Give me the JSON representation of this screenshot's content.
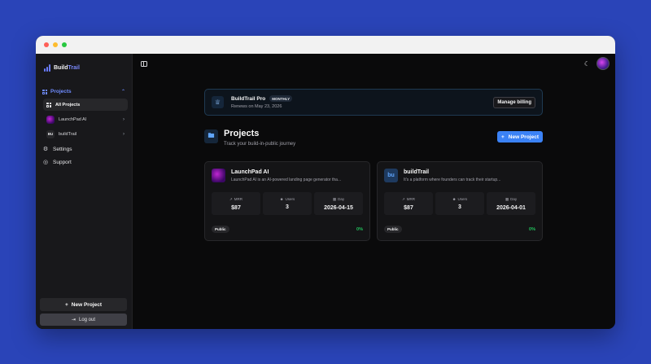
{
  "brand": {
    "name_part1": "Build",
    "name_part2": "Trail"
  },
  "sidebar": {
    "projects_label": "Projects",
    "all_projects_label": "All Projects",
    "projects": [
      {
        "name": "LaunchPad AI"
      },
      {
        "name": "buildTrail",
        "mono": "BU"
      }
    ],
    "settings_label": "Settings",
    "support_label": "Support",
    "new_project_label": "New Project",
    "logout_label": "Log out"
  },
  "billing": {
    "plan": "BuildTrail Pro",
    "badge": "MONTHLY",
    "renews": "Renews on May 23, 2026",
    "manage_label": "Manage billing"
  },
  "page": {
    "title": "Projects",
    "subtitle": "Track your build-in-public journey",
    "new_project_label": "New Project"
  },
  "cards": [
    {
      "name": "LaunchPad AI",
      "desc": "LaunchPad AI is an AI-powered landing page generator tha...",
      "mrr_label": "MRR",
      "mrr": "$87",
      "users_label": "Users",
      "users": "3",
      "day_label": "Day",
      "day": "2026-04-15",
      "visibility": "Public",
      "progress": "0%"
    },
    {
      "name": "buildTrail",
      "mono": "bu",
      "desc": "It's a platform where founders can track their startup...",
      "mrr_label": "MRR",
      "mrr": "$87",
      "users_label": "Users",
      "users": "3",
      "day_label": "Day",
      "day": "2026-04-01",
      "visibility": "Public",
      "progress": "0%"
    }
  ],
  "colors": {
    "accent": "#3b82f6",
    "background": "#2a44b8",
    "success": "#22c55e"
  }
}
